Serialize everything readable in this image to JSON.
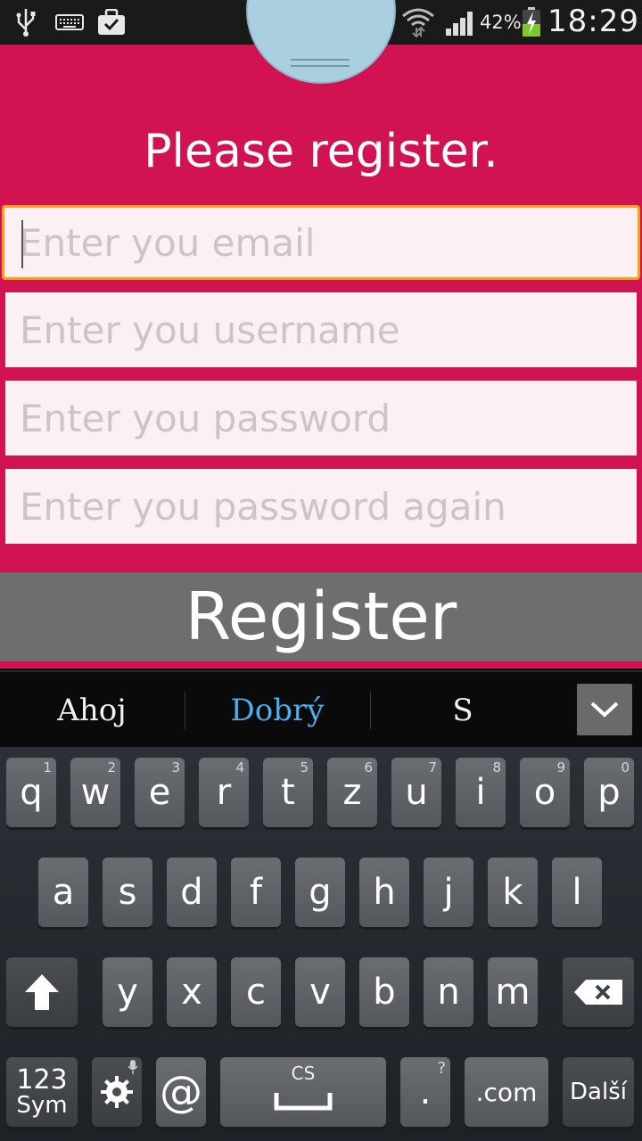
{
  "status_bar": {
    "battery_percent": "42%",
    "time": "18:29",
    "icons": [
      "usb-icon",
      "keyboard-icon",
      "briefcase-icon",
      "wifi-icon",
      "signal-icon",
      "battery-charging-icon"
    ]
  },
  "app": {
    "title": "Please register.",
    "email_placeholder": "Enter you email",
    "username_placeholder": "Enter you username",
    "password_placeholder": "Enter you password",
    "password_again_placeholder": "Enter you password again",
    "register_label": "Register",
    "accent_color": "#d11352",
    "focus_color": "#ff9c1a"
  },
  "keyboard": {
    "suggestions": [
      "Ahoj",
      "Dobrý",
      "S"
    ],
    "row1": [
      "q",
      "w",
      "e",
      "r",
      "t",
      "z",
      "u",
      "i",
      "o",
      "p"
    ],
    "row1_nums": [
      "1",
      "2",
      "3",
      "4",
      "5",
      "6",
      "7",
      "8",
      "9",
      "0"
    ],
    "row2": [
      "a",
      "s",
      "d",
      "f",
      "g",
      "h",
      "j",
      "k",
      "l"
    ],
    "row3": [
      "y",
      "x",
      "c",
      "v",
      "b",
      "n",
      "m"
    ],
    "sym_top": "123",
    "sym_bottom": "Sym",
    "at": "@",
    "space_lang": "CS",
    "period": ".",
    "period_hint": "?",
    "dotcom": ".com",
    "next": "Další"
  }
}
